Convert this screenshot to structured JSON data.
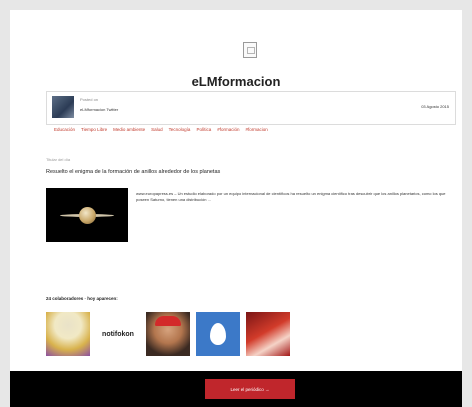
{
  "site": {
    "title": "eLMformacion"
  },
  "post": {
    "posted_by_label": "Posted on",
    "author": "eLMformacion Twitter",
    "date": "03 Agosto 2015"
  },
  "tags": [
    "Educación",
    "Tiempo Libre",
    "Medio ambiente",
    "Salud",
    "Tecnología",
    "Política",
    "#formación",
    "#formacion"
  ],
  "article": {
    "topic_label": "Titular del día",
    "title": "Resuelto el enigma de la formación de anillos alrededor de los planetas",
    "excerpt": "www.europapress.es – Un estudio elaborado por un equipo internacional de científicos ha resuelto un enigma científico tras descubrir que los anillos planetarios, como los que poseen Saturno, tienen una distribución ..."
  },
  "collaborators": {
    "label": "24 colaboradores · hoy aparecen:",
    "notifokon_text": "notifokon"
  },
  "footer": {
    "button_label": "Leer el periódico →"
  }
}
